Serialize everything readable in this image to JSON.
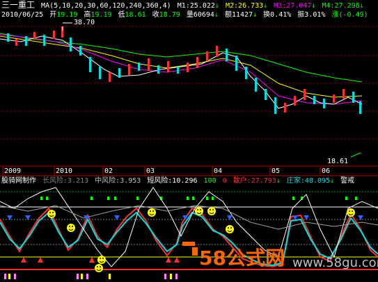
{
  "header": {
    "title": "三一重工",
    "ma_label": "MA(5,10,20,30,60,120,240,360,4)",
    "m1": "M1:25.022",
    "m2": "M2:26.733",
    "m3": "M3:27.047",
    "m4": "M4:27.298",
    "arrow_down": "↓",
    "arrow_up": "↑"
  },
  "quote": {
    "date": "2010/06/25",
    "open_label": "开",
    "open": "19.19",
    "high_label": "高",
    "high": "19.19",
    "low_label": "低",
    "low": "18.61",
    "close_label": "收",
    "close": "18.79",
    "volume_label": "量",
    "volume": "60694",
    "amount_label": "额",
    "amount": "11427",
    "turnover_label": "换",
    "turnover": "0.41%",
    "amplitude_label": "振",
    "amplitude": "3.01%",
    "change_label": "涨",
    "change": "(-0.49)"
  },
  "price_annotations": {
    "high_marker": "38.70",
    "low_marker": "18.61"
  },
  "time_axis": {
    "labels": [
      "2009",
      "2010",
      "02",
      "03",
      "04",
      "05",
      "06"
    ]
  },
  "indicator": {
    "name": "股骑网制作",
    "long_risk": "长风险:3.213",
    "mid_risk": "中风险:3.953",
    "short_risk": "短风险:10.296",
    "value_100": "100",
    "value_0": "0",
    "retail": "散户:27.793",
    "dealer": "庄家:48.095",
    "alert": "警戒"
  },
  "watermark": {
    "brand": "58公式网",
    "url": "www.58gu.com"
  },
  "colors": {
    "up": "#ff3030",
    "down": "#00e0e0",
    "green": "#00ff00",
    "yellow": "#ffff00",
    "white": "#ffffff",
    "magenta": "#ff00ff",
    "blue": "#3060ff",
    "grid_red": "#a00000"
  }
}
